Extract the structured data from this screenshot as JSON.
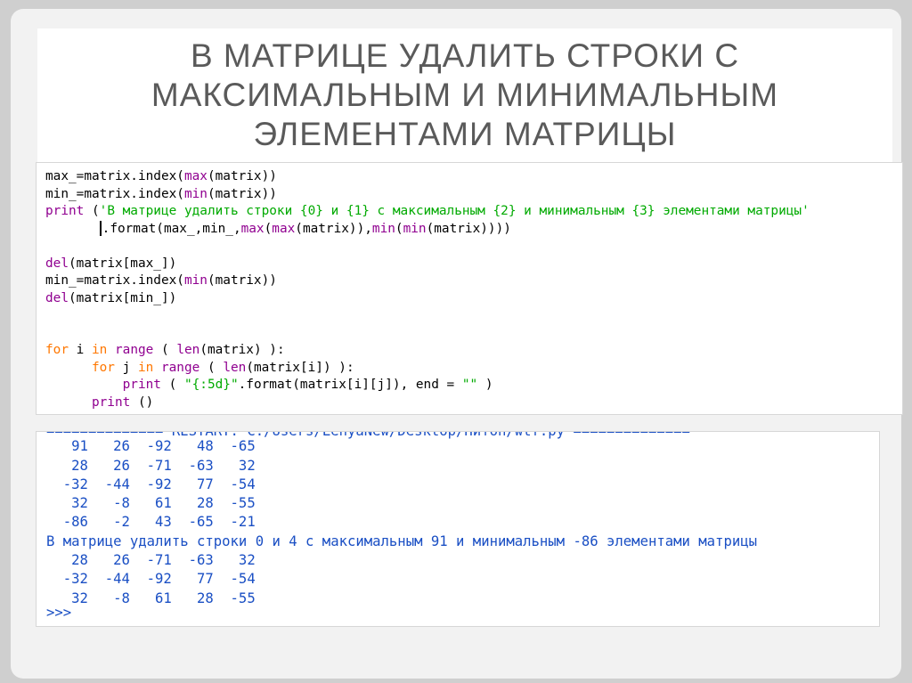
{
  "title": {
    "lines": [
      "В МАТРИЦЕ УДАЛИТЬ СТРОКИ С",
      "МАКСИМАЛЬНЫМ И МИНИМАЛЬНЫМ",
      "ЭЛЕМЕНТАМИ МАТРИЦЫ"
    ]
  },
  "code": {
    "l1": {
      "a": "max_=matrix.index(",
      "b": "max",
      "c": "(matrix))"
    },
    "l2": {
      "a": "min_=matrix.index(",
      "b": "min",
      "c": "(matrix))"
    },
    "l3": {
      "kw": "print",
      "sp": " (",
      "str": "'В матрице удалить строки {0} и {1} с максимальным {2} и минимальным {3} элементами матрицы'"
    },
    "l4": {
      "indent": "       ",
      "a": ".format(max_,min_,",
      "b1": "max",
      "p1": "(",
      "b2": "max",
      "p2": "(matrix)),",
      "b3": "min",
      "p3": "(",
      "b4": "min",
      "p4": "(matrix))))"
    },
    "l6": {
      "kw": "del",
      "rest": "(matrix[max_])"
    },
    "l7": {
      "a": "min_=matrix.index(",
      "b": "min",
      "c": "(matrix))"
    },
    "l8": {
      "kw": "del",
      "rest": "(matrix[min_])"
    },
    "l11": {
      "kw1": "for",
      "v": " i ",
      "kw2": "in",
      "sp": " ",
      "b1": "range",
      "p": " ( ",
      "b2": "len",
      "rest": "(matrix) ):"
    },
    "l12": {
      "indent": "      ",
      "kw1": "for",
      "v": " j ",
      "kw2": "in",
      "sp": " ",
      "b1": "range",
      "p": " ( ",
      "b2": "len",
      "rest": "(matrix[i]) ):"
    },
    "l13": {
      "indent": "          ",
      "kw": "print",
      "p": " ( ",
      "str": "\"{:5d}\"",
      "a": ".format(matrix[i][j]), end = ",
      "str2": "\"\"",
      "e": " )"
    },
    "l14": {
      "indent": "      ",
      "kw": "print",
      "rest": " ()"
    }
  },
  "output": {
    "restart": "============== RESTART: C:/Users/LenyaNew/Desktop/Питон/wtf.py ==============",
    "lines": [
      "   91   26  -92   48  -65",
      "   28   26  -71  -63   32",
      "  -32  -44  -92   77  -54",
      "   32   -8   61   28  -55",
      "  -86   -2   43  -65  -21",
      "В матрице удалить строки 0 и 4 с максимальным 91 и минимальным -86 элементами матрицы",
      "   28   26  -71  -63   32",
      "  -32  -44  -92   77  -54",
      "   32   -8   61   28  -55"
    ],
    "prompt": ">>>"
  }
}
